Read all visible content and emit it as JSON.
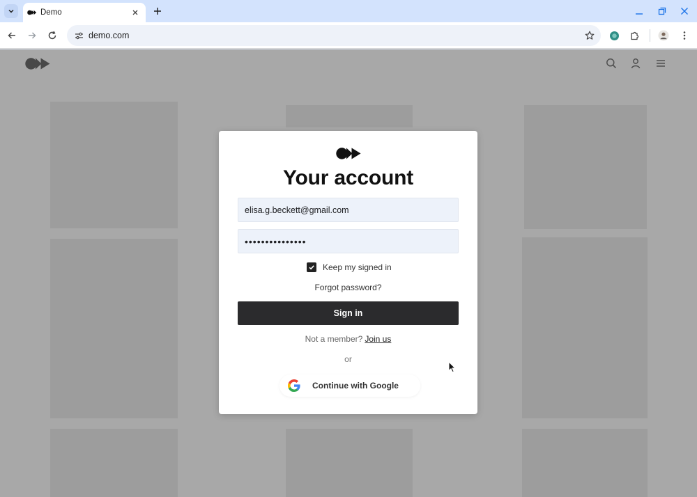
{
  "browser": {
    "tab": {
      "title": "Demo"
    },
    "address_bar": {
      "url": "demo.com"
    },
    "colors": {
      "tabstrip": "#d3e3fd",
      "toolbar": "#ffffff"
    },
    "icons": [
      "tab-list-icon",
      "close-icon",
      "plus-icon",
      "minimize-icon",
      "restore-icon",
      "back-icon",
      "forward-icon",
      "reload-icon",
      "site-info-icon",
      "star-icon",
      "extension-icon",
      "puzzle-icon",
      "profile-icon",
      "kebab-menu-icon"
    ]
  },
  "site_header": {
    "logo": "site-logo",
    "icons": [
      "search-icon",
      "user-icon",
      "hamburger-menu-icon"
    ]
  },
  "login_modal": {
    "title": "Your account",
    "email": {
      "value": "elisa.g.beckett@gmail.com"
    },
    "password": {
      "masked_value": "•••••••••••••••"
    },
    "remember": {
      "label": "Keep my signed in",
      "checked": true
    },
    "forgot_label": "Forgot password?",
    "signin_label": "Sign in",
    "member_prompt": "Not a member?",
    "join_label": "Join us",
    "or_label": "or",
    "google_label": "Continue with Google",
    "colors": {
      "primary_button": "#2b2b2d",
      "field_bg": "#edf2fa",
      "overlay": "rgba(110,110,110,0.6)"
    }
  }
}
